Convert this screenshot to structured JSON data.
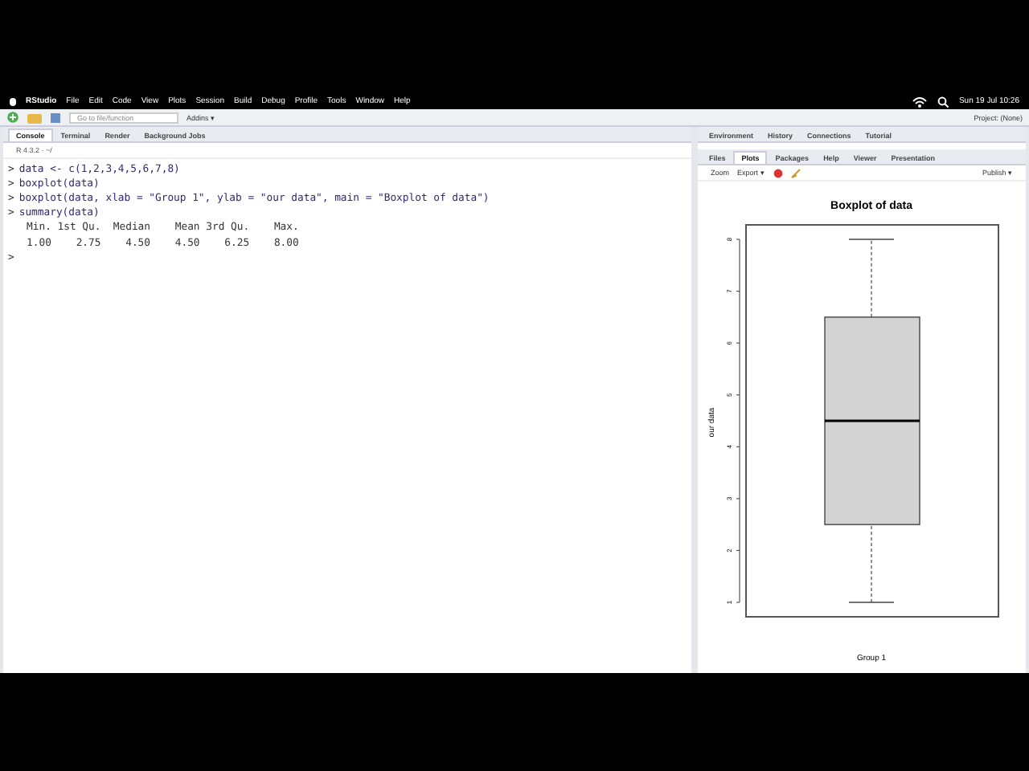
{
  "menu_bar": {
    "app": "RStudio",
    "items": [
      "File",
      "Edit",
      "Code",
      "View",
      "Plots",
      "Session",
      "Build",
      "Debug",
      "Profile",
      "Tools",
      "Window",
      "Help"
    ],
    "clock": "Sun 19 Jul 10:26"
  },
  "toolbar": {
    "goto_placeholder": "Go to file/function",
    "addins": "Addins ▾",
    "project": "Project: (None)"
  },
  "console_pane": {
    "tabs": [
      {
        "label": "Console",
        "selected": true
      },
      {
        "label": "Terminal",
        "selected": false
      },
      {
        "label": "Render",
        "selected": false
      },
      {
        "label": "Background Jobs",
        "selected": false
      }
    ],
    "version": "R 4.3.2 · ~/",
    "lines": [
      {
        "kind": "input",
        "text": "data <- c(1,2,3,4,5,6,7,8)"
      },
      {
        "kind": "input",
        "text": "boxplot(data)"
      },
      {
        "kind": "input",
        "text": "boxplot(data, xlab = \"Group 1\", ylab = \"our data\", main = \"Boxplot of data\")"
      },
      {
        "kind": "input",
        "text": "summary(data)"
      },
      {
        "kind": "output",
        "text": "   Min. 1st Qu.  Median    Mean 3rd Qu.    Max. "
      },
      {
        "kind": "output",
        "text": "   1.00    2.75    4.50    4.50    6.25    8.00 "
      },
      {
        "kind": "prompt"
      }
    ],
    "prompt": ">"
  },
  "environment_pane": {
    "tabs": [
      {
        "label": "Environment",
        "selected": false
      },
      {
        "label": "History",
        "selected": false
      },
      {
        "label": "Connections",
        "selected": false
      },
      {
        "label": "Tutorial",
        "selected": false
      }
    ]
  },
  "plots_pane": {
    "tabs": [
      {
        "label": "Files",
        "selected": false
      },
      {
        "label": "Plots",
        "selected": true
      },
      {
        "label": "Packages",
        "selected": false
      },
      {
        "label": "Help",
        "selected": false
      },
      {
        "label": "Viewer",
        "selected": false
      },
      {
        "label": "Presentation",
        "selected": false
      }
    ],
    "zoom": "Zoom",
    "export": "Export ▾",
    "publish": "Publish ▾",
    "plot": {
      "title": "Boxplot of data",
      "xlabel": "Group 1",
      "ylabel": "our data",
      "y_tick_labels": [
        "1",
        "2",
        "3",
        "4",
        "5",
        "6",
        "7",
        "8"
      ]
    }
  }
}
